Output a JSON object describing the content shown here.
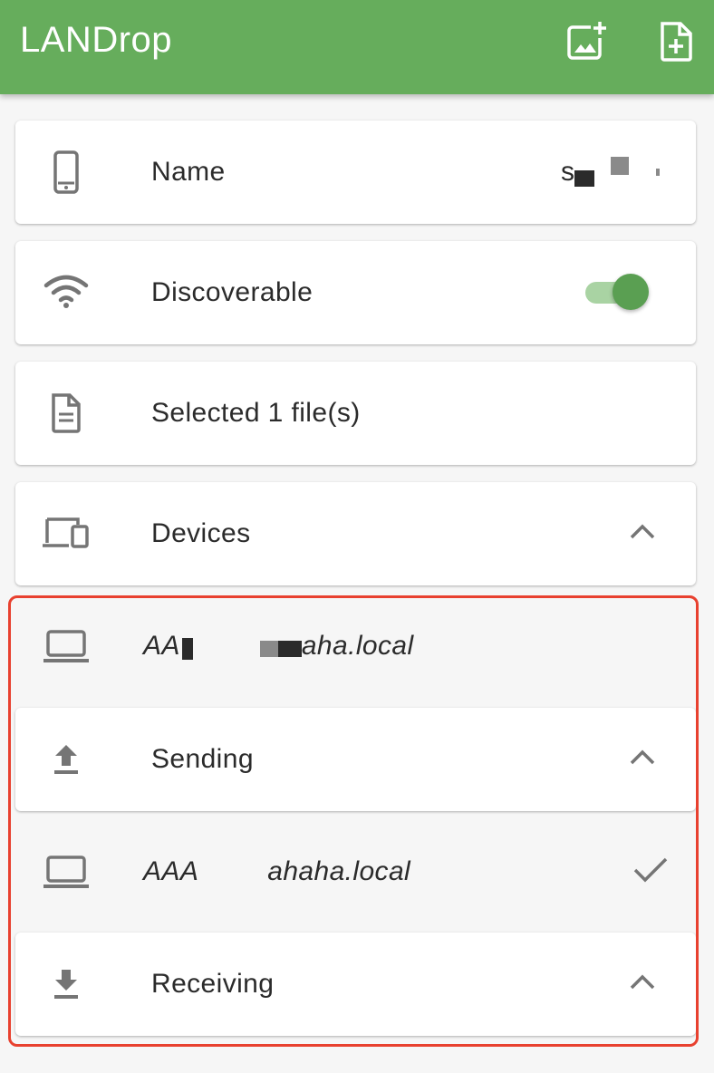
{
  "app": {
    "title": "LANDrop",
    "actions": [
      {
        "icon": "add-photo-icon"
      },
      {
        "icon": "add-file-icon"
      }
    ]
  },
  "settings": {
    "name": {
      "label": "Name",
      "value": "s",
      "icon": "phone-icon"
    },
    "discoverable": {
      "label": "Discoverable",
      "enabled": true,
      "icon": "wifi-icon",
      "accent": "#5a9f52"
    },
    "files": {
      "label": "Selected 1 file(s)",
      "icon": "file-icon"
    }
  },
  "devices": {
    "label": "Devices",
    "icon": "devices-icon",
    "expanded": true,
    "items": [
      {
        "name_start": "AA",
        "name_end": "aha.local",
        "icon": "laptop-icon"
      }
    ]
  },
  "sending": {
    "label": "Sending",
    "icon": "upload-icon",
    "expanded": true,
    "items": [
      {
        "name_start": "AAA",
        "name_end": "ahaha.local",
        "icon": "laptop-icon",
        "status_icon": "check-icon"
      }
    ]
  },
  "receiving": {
    "label": "Receiving",
    "icon": "download-icon",
    "expanded": true
  },
  "colors": {
    "primary": "#66ad5c",
    "highlight_border": "#e8412f",
    "icon_grey": "#757575"
  }
}
